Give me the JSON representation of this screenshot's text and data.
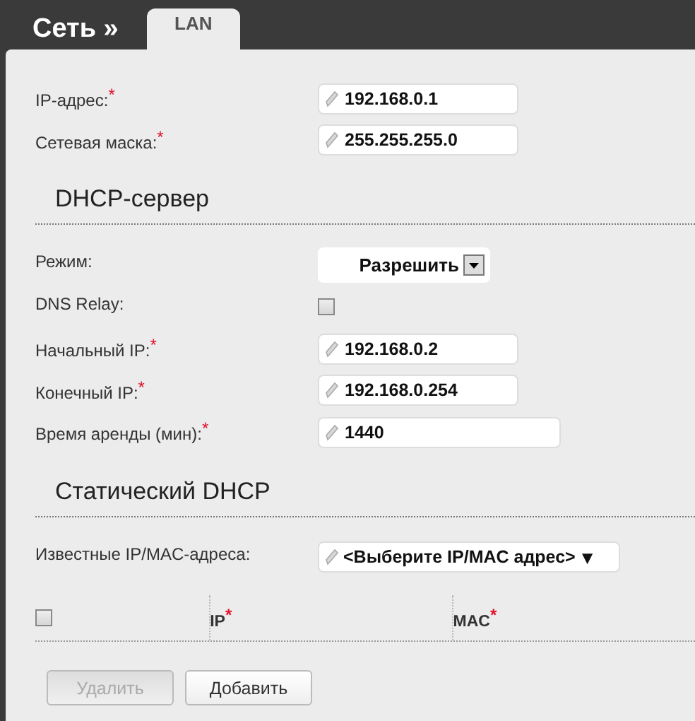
{
  "header": {
    "title": "Сеть »",
    "tabs": [
      {
        "label": "LAN",
        "selected": true
      }
    ]
  },
  "fields": [
    {
      "kind": "text",
      "label": "IP-адрес:",
      "required_mark": "*",
      "value": "192.168.0.1"
    },
    {
      "kind": "text",
      "label": "Сетевая маска:",
      "required_mark": "*",
      "value": "255.255.255.0"
    }
  ],
  "sections": [
    {
      "title": "DHCP-сервер",
      "fields": [
        {
          "kind": "select",
          "label": "Режим:",
          "value": "Разрешить"
        },
        {
          "kind": "checkbox",
          "label": "DNS Relay:",
          "checked": false
        },
        {
          "kind": "text",
          "label": "Начальный IP:",
          "required_mark": "*",
          "value": "192.168.0.2"
        },
        {
          "kind": "text",
          "label": "Конечный IP:",
          "required_mark": "*",
          "value": "192.168.0.254"
        },
        {
          "kind": "wide",
          "label": "Время аренды (мин):",
          "required_mark": "*",
          "value": "1440"
        }
      ]
    },
    {
      "title": "Статический DHCP",
      "fields": [
        {
          "kind": "combo",
          "label": "Известные IP/MAC-адреса:",
          "value": "<Выберите IP/MAC адрес>",
          "arrow": "▼"
        }
      ]
    }
  ],
  "table": {
    "select_all": {
      "checked": false
    },
    "columns": [
      {
        "label": "IP",
        "required_mark": "*"
      },
      {
        "label": "MAC",
        "required_mark": "*"
      }
    ]
  },
  "buttons": [
    {
      "label": "Удалить",
      "disabled": true
    },
    {
      "label": "Добавить",
      "disabled": false
    }
  ]
}
